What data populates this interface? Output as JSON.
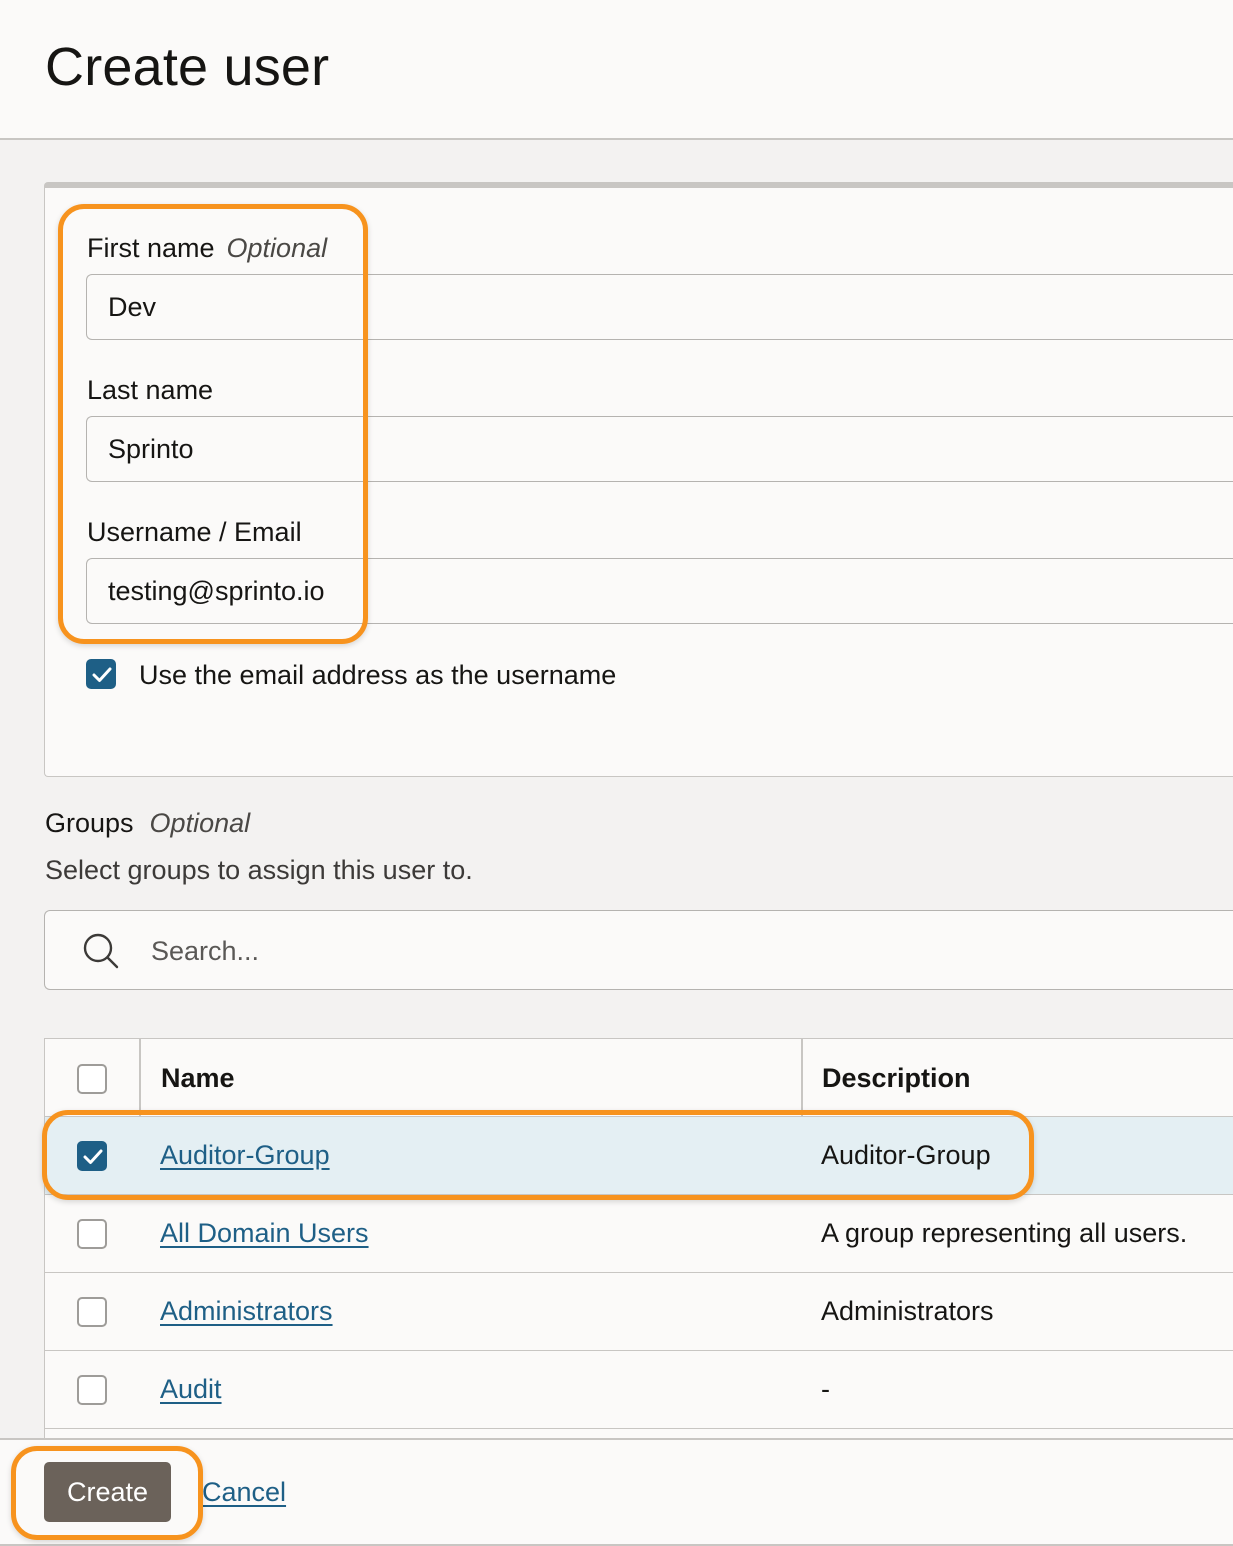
{
  "page": {
    "title": "Create user"
  },
  "form": {
    "first_name": {
      "label": "First name",
      "optional": "Optional",
      "value": "Dev"
    },
    "last_name": {
      "label": "Last name",
      "value": "Sprinto"
    },
    "username": {
      "label": "Username / Email",
      "value": "testing@sprinto.io"
    },
    "use_email_checkbox": {
      "label": "Use the email address as the username",
      "checked": true
    }
  },
  "groups": {
    "title": "Groups",
    "optional": "Optional",
    "subtitle": "Select groups to assign this user to.",
    "search": {
      "placeholder": "Search..."
    },
    "table": {
      "headers": {
        "name": "Name",
        "description": "Description"
      },
      "rows": [
        {
          "name": "Auditor-Group",
          "description": "Auditor-Group",
          "checked": true
        },
        {
          "name": "All Domain Users",
          "description": "A group representing all users.",
          "checked": false
        },
        {
          "name": "Administrators",
          "description": "Administrators",
          "checked": false
        },
        {
          "name": "Audit",
          "description": "-",
          "checked": false
        }
      ]
    }
  },
  "actions": {
    "create_label": "Create",
    "cancel_label": "Cancel"
  },
  "colors": {
    "accent": "#1e5f86",
    "highlight": "#f7931e",
    "primary_button": "#6b625a"
  },
  "icons": {
    "search": "search-icon",
    "check": "check-icon"
  }
}
